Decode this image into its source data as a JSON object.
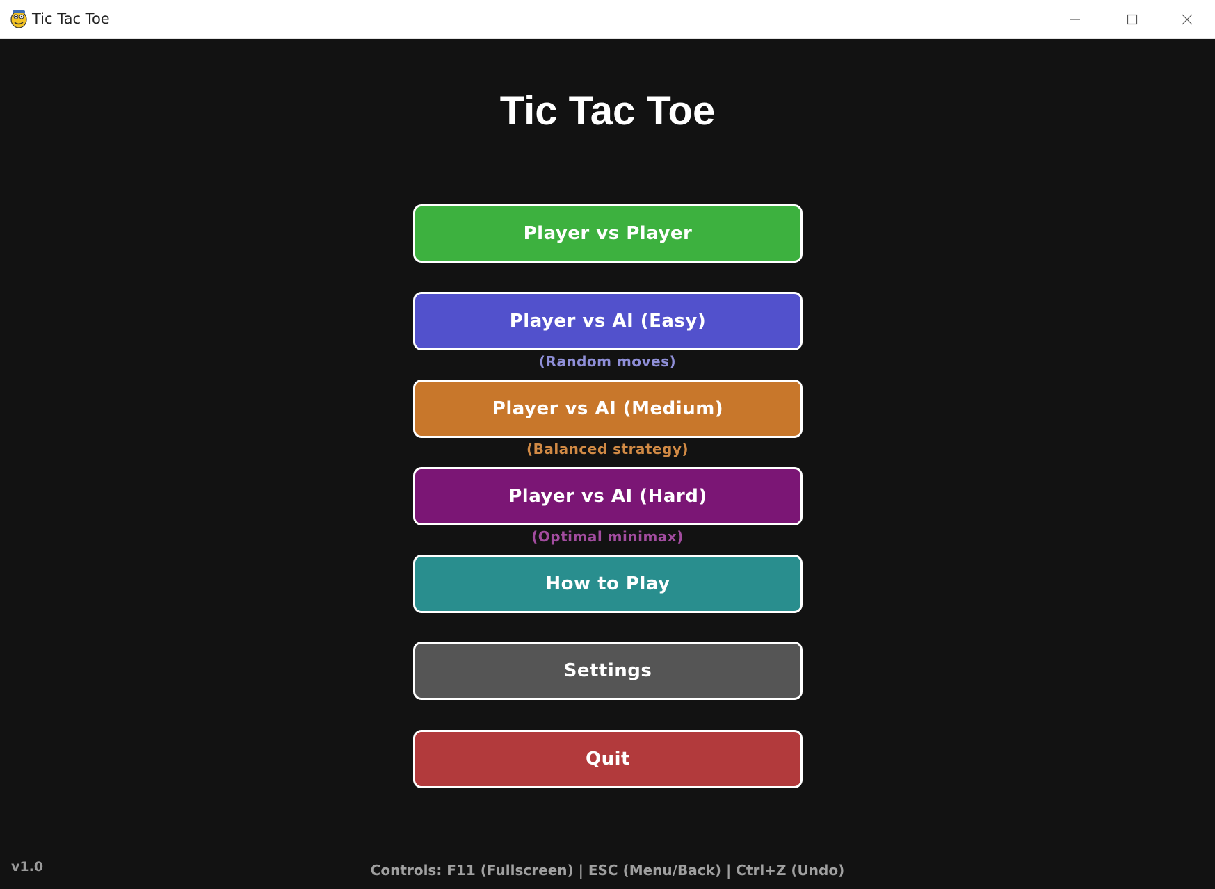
{
  "window": {
    "title": "Tic Tac Toe",
    "icon": "pygame-snake-icon",
    "controls": [
      "minimize-icon",
      "maximize-icon",
      "close-icon"
    ]
  },
  "menu": {
    "title": "Tic Tac Toe",
    "buttons": [
      {
        "label": "Player vs Player",
        "color": "#3db13f"
      },
      {
        "label": "Player vs AI (Easy)",
        "color": "#5251cc",
        "subtitle": "(Random moves)",
        "subtitle_color": "#8f8fd8"
      },
      {
        "label": "Player vs AI (Medium)",
        "color": "#c8772b",
        "subtitle": "(Balanced strategy)",
        "subtitle_color": "#d18a45"
      },
      {
        "label": "Player vs AI (Hard)",
        "color": "#7b1675",
        "subtitle": "(Optimal minimax)",
        "subtitle_color": "#a24c9f"
      },
      {
        "label": "How to Play",
        "color": "#298e8e"
      },
      {
        "label": "Settings",
        "color": "#555555"
      },
      {
        "label": "Quit",
        "color": "#b23a3c"
      }
    ]
  },
  "footer": {
    "version": "v1.0",
    "controls": "Controls: F11 (Fullscreen) | ESC (Menu/Back) | Ctrl+Z (Undo)"
  }
}
